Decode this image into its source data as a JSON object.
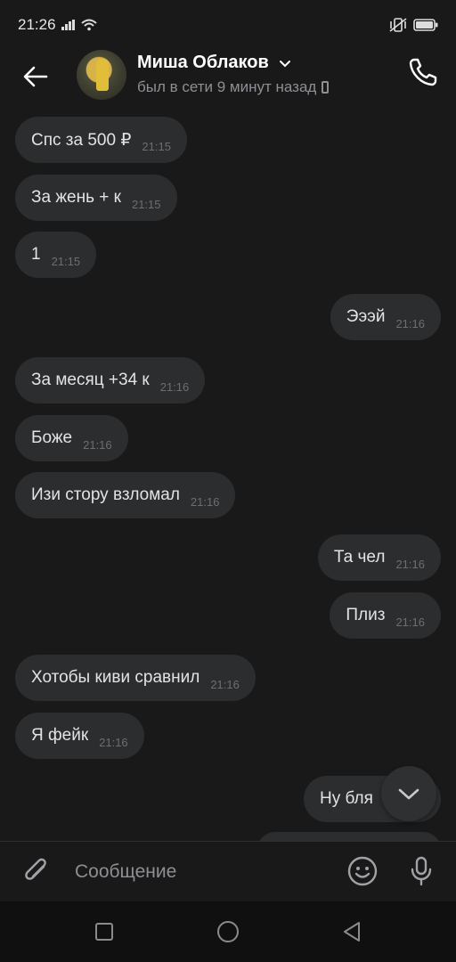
{
  "status_bar": {
    "time": "21:26"
  },
  "header": {
    "contact_name": "Миша Облаков",
    "last_seen": "был в сети 9 минут назад"
  },
  "messages": [
    {
      "dir": "in",
      "text": "Спс за 500 ₽",
      "time": "21:15"
    },
    {
      "dir": "in",
      "text": "За жень +  к",
      "time": "21:15"
    },
    {
      "dir": "in",
      "text": "1",
      "time": "21:15"
    },
    {
      "dir": "out",
      "text": "Эээй",
      "time": "21:16"
    },
    {
      "dir": "in",
      "text": "За месяц +34 к",
      "time": "21:16"
    },
    {
      "dir": "in",
      "text": "Боже",
      "time": "21:16"
    },
    {
      "dir": "in",
      "text": "Изи стору взломал",
      "time": "21:16"
    },
    {
      "dir": "out",
      "text": "Та чел",
      "time": "21:16"
    },
    {
      "dir": "out",
      "text": "Плиз",
      "time": "21:16"
    },
    {
      "dir": "in",
      "text": "Хотобы киви сравнил",
      "time": "21:16"
    },
    {
      "dir": "in",
      "text": "Я фейк",
      "time": "21:16"
    },
    {
      "dir": "out",
      "text": "Ну бля",
      "time": ""
    }
  ],
  "composer": {
    "placeholder": "Сообщение"
  },
  "colors": {
    "background": "#19191a",
    "bubble": "#2c2d2e",
    "text": "#e1e3e6",
    "muted": "#8e8f93"
  },
  "icons": [
    "back-arrow-icon",
    "chevron-down-icon",
    "phone-icon",
    "paperclip-icon",
    "emoji-icon",
    "microphone-icon",
    "scroll-down-icon",
    "nav-square-icon",
    "nav-circle-icon",
    "nav-triangle-icon"
  ]
}
